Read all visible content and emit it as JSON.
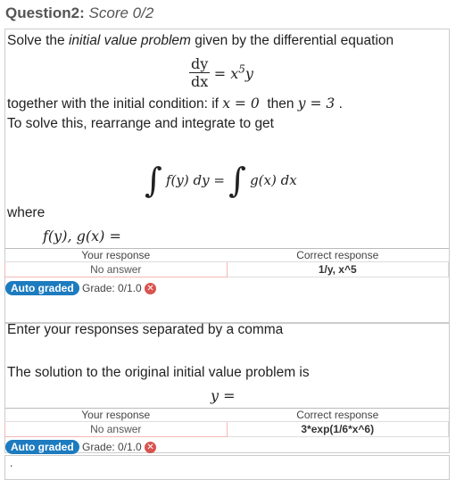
{
  "question": {
    "title": "Question2:",
    "score": "Score 0/2"
  },
  "part1": {
    "prompt_a": "Solve the ",
    "prompt_em": "initial value problem",
    "prompt_b": " given by the differential equation",
    "eq_num": "dy",
    "eq_den": "dx",
    "eq_rhs": "= x",
    "eq_exp": "5",
    "eq_y": "y",
    "cond_a": "together with the initial condition: if ",
    "cond_x": "x = 0",
    "cond_mid": "  then ",
    "cond_y": "y = 3",
    "cond_end": " .",
    "rearrange": "To solve this, rearrange and integrate to get",
    "int_left": "f(y) dy =",
    "int_right": "g(x) dx",
    "where": "where",
    "fg": "f(y), g(x) ="
  },
  "table1": {
    "your_header": "Your response",
    "correct_header": "Correct response",
    "your_value": "No answer",
    "correct_value": "1/y, x^5"
  },
  "grade1": {
    "badge": "Auto graded",
    "grade": "Grade: 0/1.0"
  },
  "part2": {
    "instruction": "Enter your responses separated by a comma",
    "solution_text": "The solution to the original initial value problem is",
    "y_eq": "y ="
  },
  "table2": {
    "your_header": "Your response",
    "correct_header": "Correct response",
    "your_value": "No answer",
    "correct_value": "3*exp(1/6*x^6)"
  },
  "grade2": {
    "badge": "Auto graded",
    "grade": "Grade: 0/1.0"
  },
  "footer": {
    "dot": "."
  }
}
